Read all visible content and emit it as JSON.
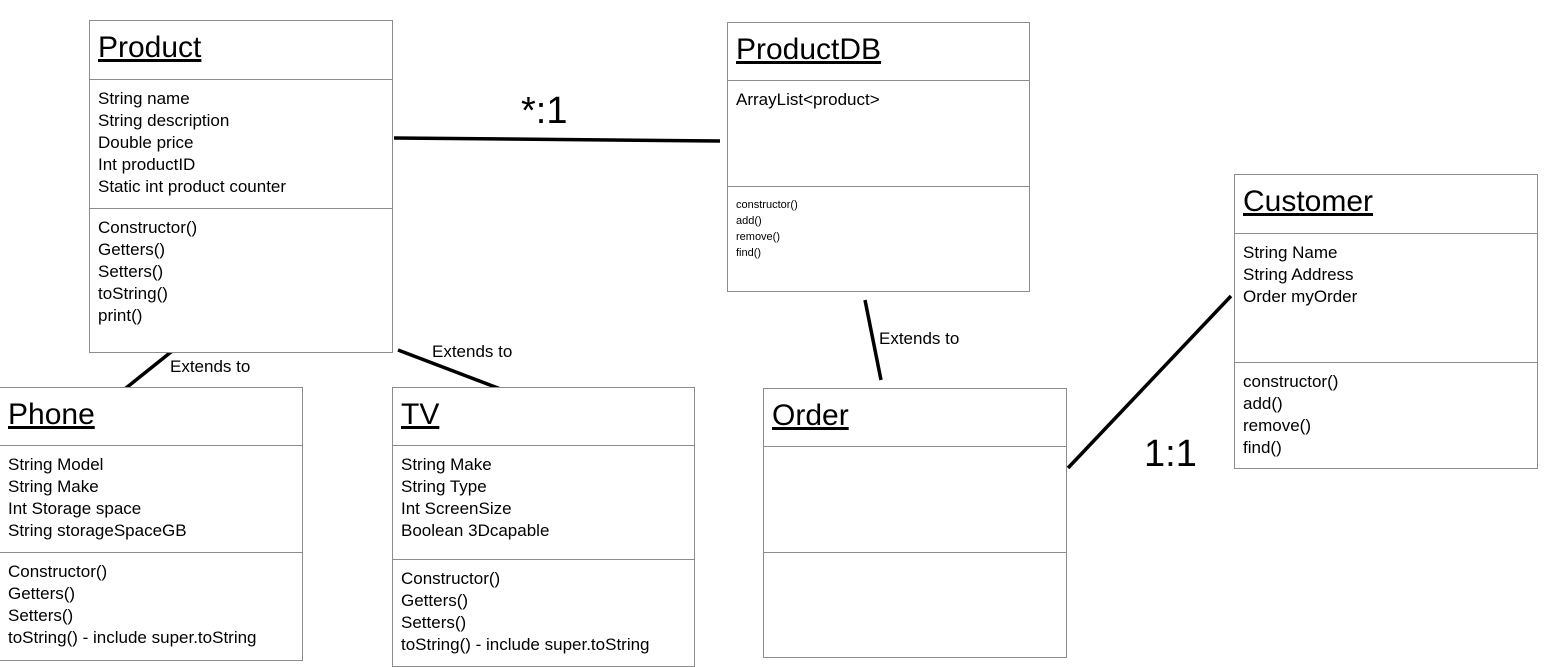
{
  "classes": {
    "product": {
      "name": "Product",
      "attributes": [
        "String name",
        "String  description",
        "Double price",
        "Int productID",
        "Static int product counter"
      ],
      "methods": [
        "Constructor()",
        "Getters()",
        "Setters()",
        "toString()",
        "print()"
      ]
    },
    "productdb": {
      "name": "ProductDB",
      "attributes": [
        "ArrayList<product>"
      ],
      "methods": [
        "constructor()",
        "add()",
        "remove()",
        "find()"
      ]
    },
    "customer": {
      "name": "Customer",
      "attributes": [
        "String Name",
        "String Address",
        "Order myOrder"
      ],
      "methods": [
        "constructor()",
        "add()",
        "remove()",
        "find()"
      ]
    },
    "phone": {
      "name": "Phone",
      "attributes": [
        "String Model",
        "String Make",
        "Int Storage space",
        "String storageSpaceGB"
      ],
      "methods": [
        "Constructor()",
        "Getters()",
        "Setters()",
        "toString() - include super.toString"
      ]
    },
    "tv": {
      "name": "TV",
      "attributes": [
        "String Make",
        "String Type",
        "Int ScreenSize",
        "Boolean 3Dcapable"
      ],
      "methods": [
        "Constructor()",
        "Getters()",
        "Setters()",
        "toString() - include super.toString"
      ]
    },
    "order": {
      "name": "Order",
      "attributes": [],
      "methods": []
    }
  },
  "relationships": {
    "product_productdb": {
      "label": "*:1"
    },
    "product_phone": {
      "label": "Extends to"
    },
    "product_tv": {
      "label": "Extends to"
    },
    "productdb_order": {
      "label": "Extends to"
    },
    "order_customer": {
      "label": "1:1"
    }
  },
  "colors": {
    "border": "#8c8c8c",
    "line": "#000000",
    "background": "#ffffff"
  }
}
